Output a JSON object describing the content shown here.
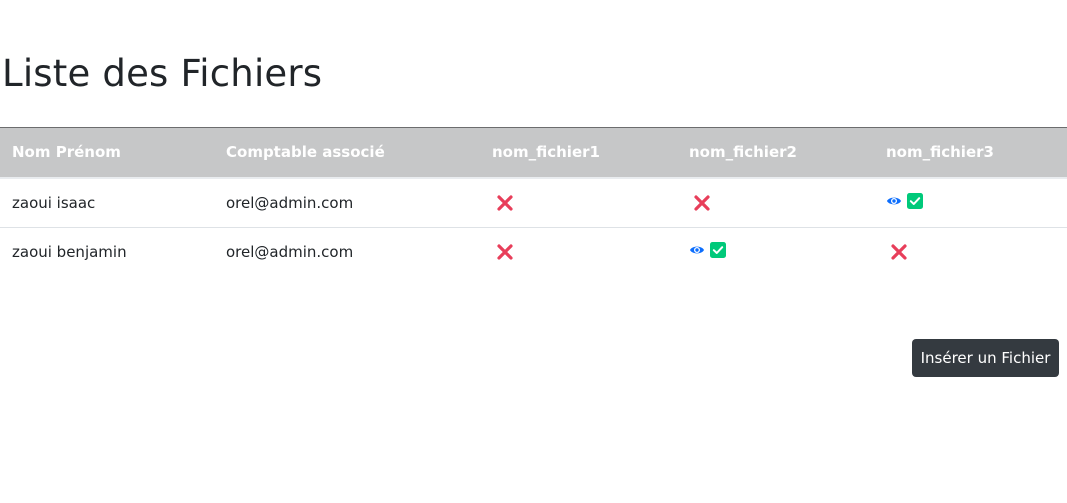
{
  "page": {
    "title": "Liste des Fichiers"
  },
  "table": {
    "headers": [
      "Nom Prénom",
      "Comptable associé",
      "nom_fichier1",
      "nom_fichier2",
      "nom_fichier3"
    ],
    "rows": [
      {
        "name": "zaoui isaac",
        "accountant": "orel@admin.com",
        "files": [
          "missing",
          "missing",
          "present"
        ]
      },
      {
        "name": "zaoui benjamin",
        "accountant": "orel@admin.com",
        "files": [
          "missing",
          "present",
          "missing"
        ]
      }
    ]
  },
  "actions": {
    "insert_label": "Insérer un Fichier"
  },
  "colors": {
    "header_bg": "#c6c7c8",
    "missing_icon": "#e83e5a",
    "eye_icon": "#0d6efd",
    "check_icon": "#00c97a",
    "button_bg": "#343a40"
  },
  "icons": {
    "missing": "x-mark-icon",
    "view": "eye-icon",
    "present": "check-square-icon"
  }
}
